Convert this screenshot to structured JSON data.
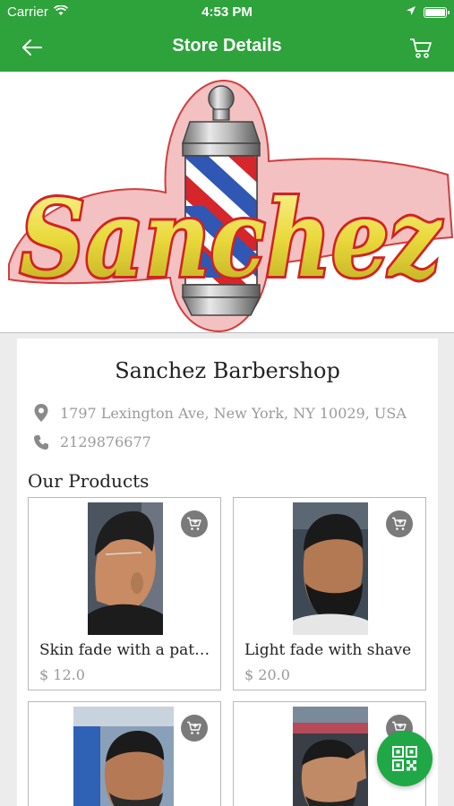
{
  "status_bar": {
    "carrier": "Carrier",
    "time": "4:53 PM"
  },
  "nav": {
    "title": "Store Details"
  },
  "banner": {
    "logo_text": "Sanchez"
  },
  "store": {
    "name": "Sanchez Barbershop",
    "address": "1797 Lexington Ave, New York, NY 10029, USA",
    "phone": "2129876677"
  },
  "products_section": {
    "title": "Our Products"
  },
  "products": [
    {
      "name": "Skin fade with a path...",
      "price": "$ 12.0"
    },
    {
      "name": "Light fade with shave",
      "price": "$ 20.0"
    },
    {
      "name": "",
      "price": ""
    },
    {
      "name": "",
      "price": ""
    }
  ],
  "colors": {
    "header_green": "#2ea33c",
    "fab_green": "#1fa845",
    "muted_text": "#9a9a9a"
  }
}
